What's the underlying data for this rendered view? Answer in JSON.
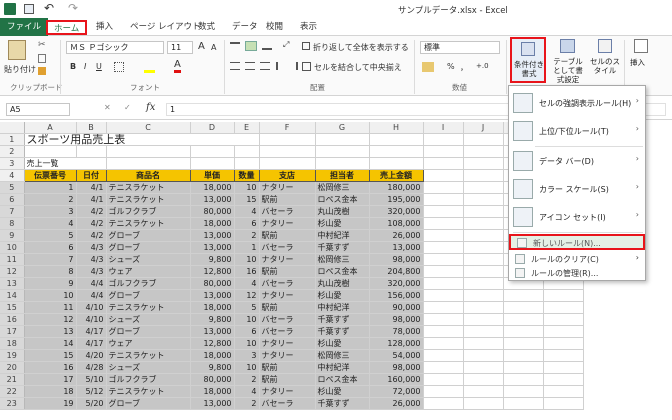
{
  "titlebar": {
    "title": "サンプルデータ.xlsx - Excel",
    "undo_icon": "↶",
    "redo_icon": "↷"
  },
  "tabs": [
    "ファイル",
    "ホーム",
    "挿入",
    "ページ レイアウト",
    "数式",
    "データ",
    "校閲",
    "表示"
  ],
  "ribbon": {
    "paste_label": "貼り付け",
    "clipboard_group": "クリップボード",
    "font_name": "ＭＳ Ｐゴシック",
    "font_size": "11",
    "font_group": "フォント",
    "wrap_text": "折り返して全体を表示する",
    "merge_center": "セルを結合して中央揃え",
    "alignment_group": "配置",
    "number_format": "標準",
    "number_group": "数値",
    "percent_label": "%",
    "comma_label": "，",
    "cond_format_label": "条件付き書式",
    "table_format_label": "テーブルとして書式設定",
    "cell_style_label": "セルのスタイル",
    "insert_label": "挿入"
  },
  "formula_bar": {
    "name_box": "A5",
    "fx": "fx",
    "content": "1"
  },
  "columns": [
    "A",
    "B",
    "C",
    "D",
    "E",
    "F",
    "G",
    "H",
    "I",
    "J",
    "K",
    "L"
  ],
  "sheet": {
    "title": "スポーツ用品売上表",
    "subtitle": "売上一覧",
    "headers": [
      "伝票番号",
      "日付",
      "商品名",
      "単価",
      "数量",
      "支店",
      "担当者",
      "売上金額"
    ],
    "rows": [
      [
        "1",
        "4/1",
        "テニスラケット",
        "18,000",
        "10",
        "ナタリー",
        "松岡修三",
        "180,000"
      ],
      [
        "2",
        "4/1",
        "テニスラケット",
        "13,000",
        "15",
        "駅前",
        "ロペス金本",
        "195,000"
      ],
      [
        "3",
        "4/2",
        "ゴルフクラブ",
        "80,000",
        "4",
        "バセーラ",
        "丸山茂樹",
        "320,000"
      ],
      [
        "4",
        "4/2",
        "テニスラケット",
        "18,000",
        "6",
        "ナタリー",
        "杉山愛",
        "108,000"
      ],
      [
        "5",
        "4/2",
        "グローブ",
        "13,000",
        "2",
        "駅前",
        "中村紀洋",
        "26,000"
      ],
      [
        "6",
        "4/3",
        "グローブ",
        "13,000",
        "1",
        "バセーラ",
        "千葉すず",
        "13,000"
      ],
      [
        "7",
        "4/3",
        "シューズ",
        "9,800",
        "10",
        "ナタリー",
        "松岡修三",
        "98,000"
      ],
      [
        "8",
        "4/3",
        "ウェア",
        "12,800",
        "16",
        "駅前",
        "ロペス金本",
        "204,800"
      ],
      [
        "9",
        "4/4",
        "ゴルフクラブ",
        "80,000",
        "4",
        "バセーラ",
        "丸山茂樹",
        "320,000"
      ],
      [
        "10",
        "4/4",
        "グローブ",
        "13,000",
        "12",
        "ナタリー",
        "杉山愛",
        "156,000"
      ],
      [
        "11",
        "4/10",
        "テニスラケット",
        "18,000",
        "5",
        "駅前",
        "中村紀洋",
        "90,000"
      ],
      [
        "12",
        "4/10",
        "シューズ",
        "9,800",
        "10",
        "バセーラ",
        "千葉すず",
        "98,000"
      ],
      [
        "13",
        "4/17",
        "グローブ",
        "13,000",
        "6",
        "バセーラ",
        "千葉すず",
        "78,000"
      ],
      [
        "14",
        "4/17",
        "ウェア",
        "12,800",
        "10",
        "ナタリー",
        "杉山愛",
        "128,000"
      ],
      [
        "15",
        "4/20",
        "テニスラケット",
        "18,000",
        "3",
        "ナタリー",
        "松岡修三",
        "54,000"
      ],
      [
        "16",
        "4/28",
        "シューズ",
        "9,800",
        "10",
        "駅前",
        "中村紀洋",
        "98,000"
      ],
      [
        "17",
        "5/10",
        "ゴルフクラブ",
        "80,000",
        "2",
        "駅前",
        "ロペス金本",
        "160,000"
      ],
      [
        "18",
        "5/12",
        "テニスラケット",
        "18,000",
        "4",
        "ナタリー",
        "杉山愛",
        "72,000"
      ],
      [
        "19",
        "5/20",
        "グローブ",
        "13,000",
        "2",
        "バセーラ",
        "千葉すず",
        "26,000"
      ]
    ]
  },
  "menu": {
    "items": [
      {
        "label": "セルの強調表示ルール(H)",
        "icon": "highlight-rules-icon"
      },
      {
        "label": "上位/下位ルール(T)",
        "icon": "top-bottom-rules-icon"
      },
      {
        "label": "データ バー(D)",
        "icon": "data-bar-icon"
      },
      {
        "label": "カラー スケール(S)",
        "icon": "color-scale-icon"
      },
      {
        "label": "アイコン セット(I)",
        "icon": "icon-set-icon"
      }
    ],
    "small_items": [
      {
        "label": "新しいルール(N)...",
        "icon": "new-rule-icon"
      },
      {
        "label": "ルールのクリア(C)",
        "icon": "clear-rules-icon"
      },
      {
        "label": "ルールの管理(R)...",
        "icon": "manage-rules-icon"
      }
    ],
    "arrow": "›"
  },
  "colors": {
    "excel_green": "#217346",
    "highlight_red": "#e8141b",
    "header_yellow": "#f5c400",
    "selection_gray": "#c6c6c6"
  }
}
